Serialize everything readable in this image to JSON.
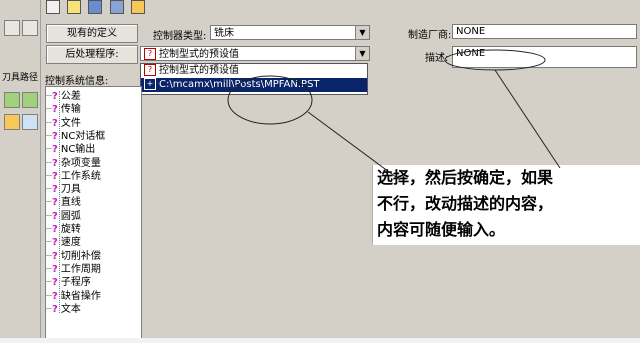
{
  "toolbar_left": {
    "panel_label": "刀具路径"
  },
  "buttons": {
    "existing_defs": "现有的定义",
    "post_program": "后处理程序:"
  },
  "controller_type": {
    "label": "控制器类型:",
    "value": "铣床"
  },
  "post_combo": {
    "value": "控制型式的预设值"
  },
  "dropdown": {
    "items": [
      {
        "label": "控制型式的预设值"
      },
      {
        "label": "C:\\mcamx\\mill\\Posts\\MPFAN.PST"
      }
    ]
  },
  "manufacturer": {
    "label": "制造厂商:",
    "value": "NONE"
  },
  "description": {
    "label": "描述:",
    "value": "NONE"
  },
  "tree": {
    "header": "控制系统信息:",
    "items": [
      "公差",
      "传输",
      "文件",
      "NC对话框",
      "NC输出",
      "杂项变量",
      "工作系统",
      "刀具",
      "直线",
      "圆弧",
      "旋转",
      "速度",
      "切削补偿",
      "工作周期",
      "子程序",
      "缺省操作",
      "文本"
    ]
  },
  "annotation": {
    "lines": [
      "选择，然后按确定，如果",
      "不行，改动描述的内容，",
      "内容可随便输入。"
    ]
  }
}
